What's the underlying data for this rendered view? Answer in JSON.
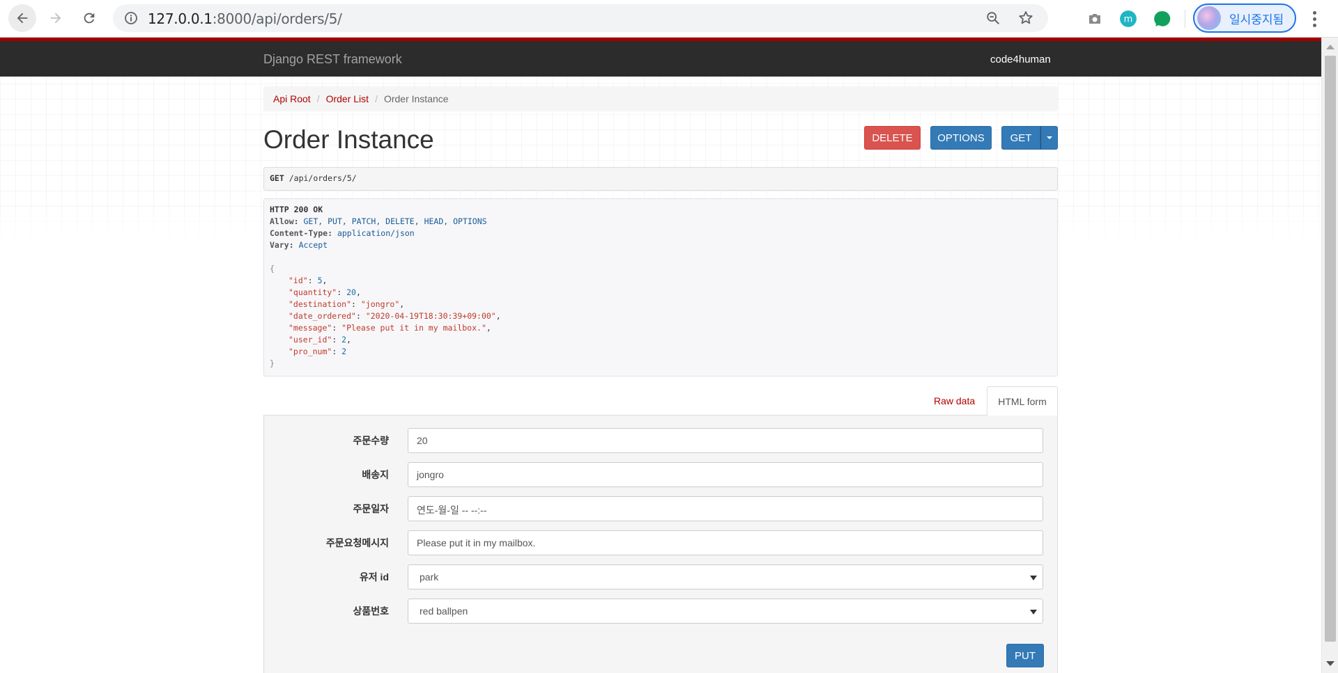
{
  "browser": {
    "url_host": "127.0.0.1",
    "url_rest": ":8000/api/orders/5/",
    "profile_label": "일시중지됨"
  },
  "navbar": {
    "brand": "Django REST framework",
    "user": "code4human"
  },
  "breadcrumb": {
    "items": [
      "Api Root",
      "Order List"
    ],
    "active": "Order Instance"
  },
  "page": {
    "title": "Order Instance"
  },
  "actions": {
    "delete_label": "DELETE",
    "options_label": "OPTIONS",
    "get_label": "GET"
  },
  "request": {
    "method": "GET",
    "path": "/api/orders/5/"
  },
  "response": {
    "status": "HTTP 200 OK",
    "headers": [
      {
        "name": "Allow:",
        "value": "GET, PUT, PATCH, DELETE, HEAD, OPTIONS"
      },
      {
        "name": "Content-Type:",
        "value": "application/json"
      },
      {
        "name": "Vary:",
        "value": "Accept"
      }
    ],
    "open_brace": "{",
    "close_brace": "}",
    "body": [
      {
        "key": "\"id\"",
        "value": "5",
        "type": "num",
        "comma": ","
      },
      {
        "key": "\"quantity\"",
        "value": "20",
        "type": "num",
        "comma": ","
      },
      {
        "key": "\"destination\"",
        "value": "\"jongro\"",
        "type": "str",
        "comma": ","
      },
      {
        "key": "\"date_ordered\"",
        "value": "\"2020-04-19T18:30:39+09:00\"",
        "type": "str",
        "comma": ","
      },
      {
        "key": "\"message\"",
        "value": "\"Please put it in my mailbox.\"",
        "type": "str",
        "comma": ","
      },
      {
        "key": "\"user_id\"",
        "value": "2",
        "type": "num",
        "comma": ","
      },
      {
        "key": "\"pro_num\"",
        "value": "2",
        "type": "num",
        "comma": ""
      }
    ]
  },
  "tabs": {
    "raw": "Raw data",
    "html": "HTML form"
  },
  "form": {
    "fields": [
      {
        "label": "주문수량",
        "value": "20",
        "kind": "input"
      },
      {
        "label": "배송지",
        "value": "jongro",
        "kind": "input"
      },
      {
        "label": "주문일자",
        "value": "연도-월-일 -- --:--",
        "kind": "input"
      },
      {
        "label": "주문요청메시지",
        "value": "Please put it in my mailbox.",
        "kind": "input"
      },
      {
        "label": "유저 id",
        "value": "park",
        "kind": "select"
      },
      {
        "label": "상품번호",
        "value": "red ballpen",
        "kind": "select"
      }
    ],
    "submit_label": "PUT"
  },
  "colors": {
    "navbar_bg": "#2c2c2c",
    "navbar_accent": "#a30000",
    "link": "#b10000",
    "primary": "#337ab7",
    "danger": "#d9534f"
  }
}
